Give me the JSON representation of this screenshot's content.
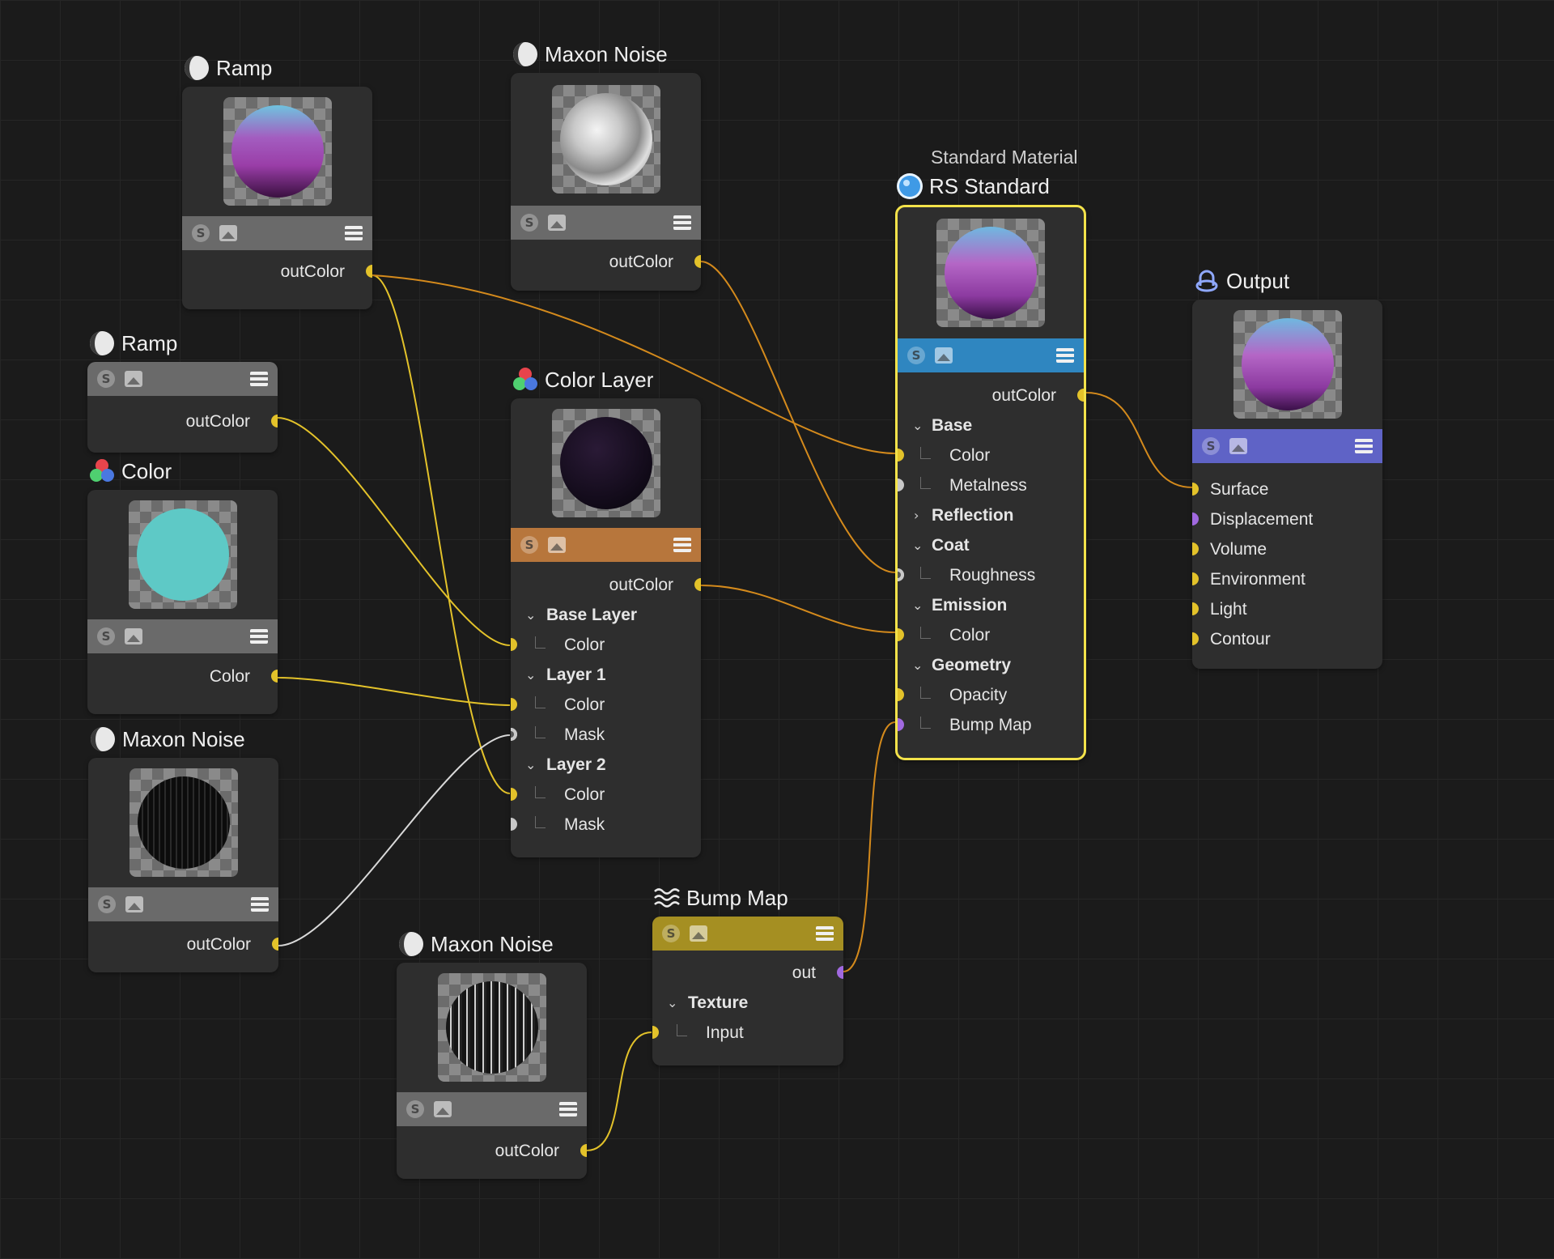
{
  "colors": {
    "canvas_bg": "#1b1b1b",
    "wire_yellow": "#e3c22a",
    "wire_orange": "#d48a1c",
    "wire_white": "#d9d9d9",
    "selected_border": "#f3e24a",
    "toolbar_grey": "#6a6a6a",
    "toolbar_orange": "#b7763c",
    "toolbar_blue": "#2f86c0",
    "toolbar_violet": "#5f63c6",
    "toolbar_olive": "#a58f22"
  },
  "nodes": {
    "ramp_top": {
      "title": "Ramp",
      "icon": "noise-shader-icon",
      "out": "outColor"
    },
    "maxon_noise_top": {
      "title": "Maxon Noise",
      "icon": "noise-shader-icon",
      "out": "outColor"
    },
    "ramp_small": {
      "title": "Ramp",
      "icon": "noise-shader-icon",
      "out": "outColor"
    },
    "color": {
      "title": "Color",
      "icon": "color-rgb-icon",
      "out": "Color"
    },
    "maxon_noise_left": {
      "title": "Maxon Noise",
      "icon": "noise-shader-icon",
      "out": "outColor"
    },
    "maxon_noise_bottom": {
      "title": "Maxon Noise",
      "icon": "noise-shader-icon",
      "out": "outColor"
    },
    "color_layer": {
      "title": "Color Layer",
      "icon": "color-rgb-icon",
      "out": "outColor",
      "base_layer": "Base Layer",
      "base_color": "Color",
      "layer1": "Layer 1",
      "layer1_color": "Color",
      "layer1_mask": "Mask",
      "layer2": "Layer 2",
      "layer2_color": "Color",
      "layer2_mask": "Mask"
    },
    "rs_standard": {
      "subtitle": "Standard Material",
      "title": "RS Standard",
      "icon": "material-sphere-icon",
      "out": "outColor",
      "base": "Base",
      "base_color": "Color",
      "base_metalness": "Metalness",
      "reflection": "Reflection",
      "coat": "Coat",
      "coat_roughness": "Roughness",
      "emission": "Emission",
      "emission_color": "Color",
      "geometry": "Geometry",
      "geometry_opacity": "Opacity",
      "geometry_bump": "Bump Map"
    },
    "output": {
      "title": "Output",
      "icon": "output-icon",
      "inputs": [
        "Surface",
        "Displacement",
        "Volume",
        "Environment",
        "Light",
        "Contour"
      ]
    },
    "bump_map": {
      "title": "Bump Map",
      "icon": "bump-wave-icon",
      "out": "out",
      "texture": "Texture",
      "input": "Input"
    }
  }
}
